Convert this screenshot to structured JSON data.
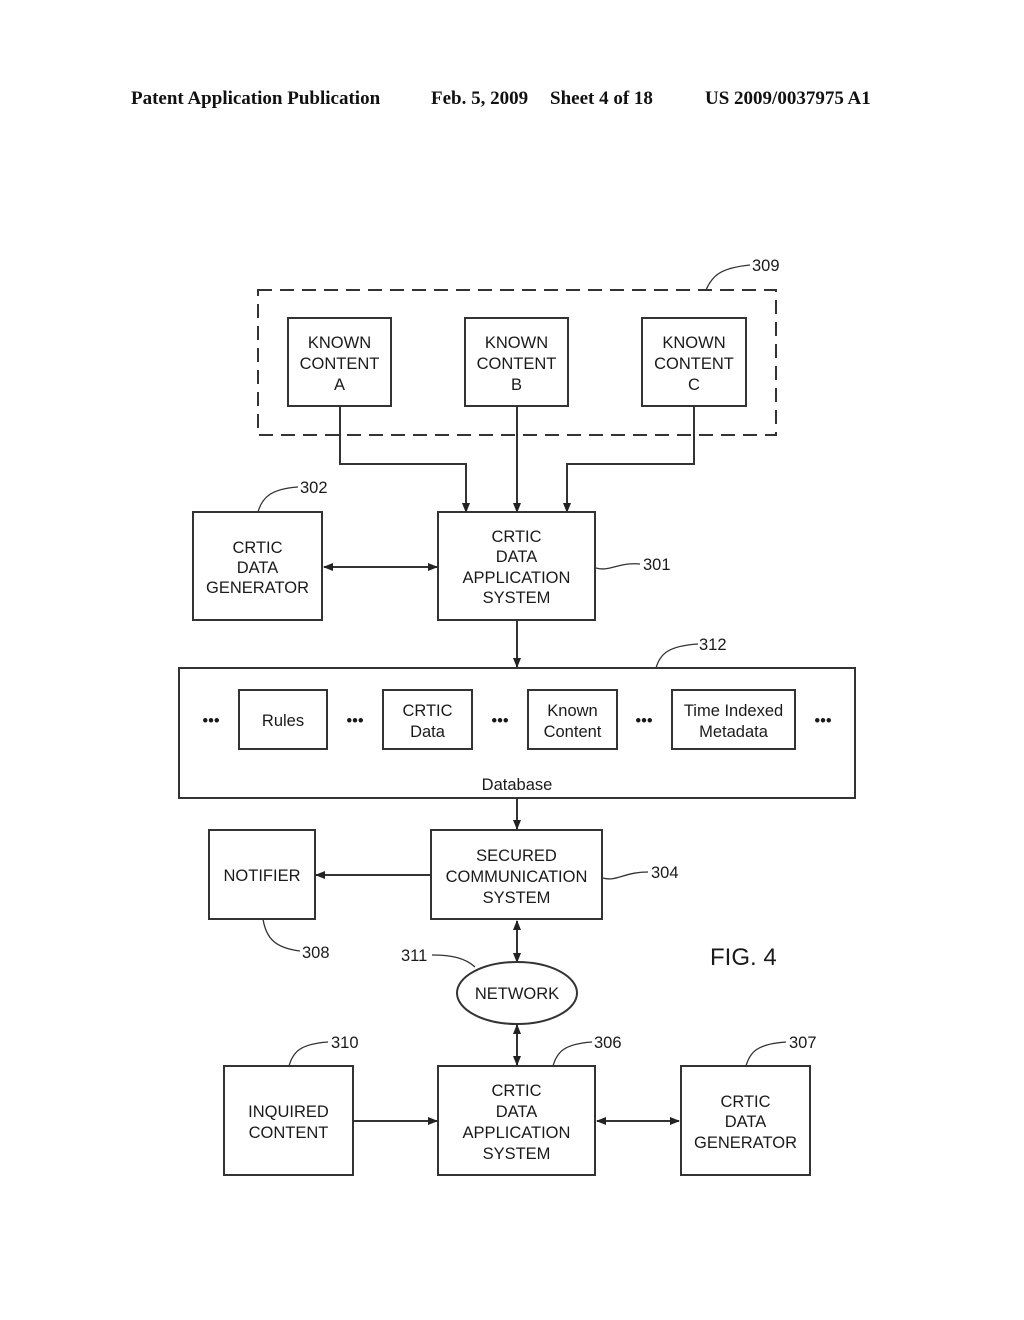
{
  "header": {
    "publication": "Patent Application Publication",
    "date": "Feb. 5, 2009",
    "sheet": "Sheet 4 of 18",
    "number": "US 2009/0037975 A1"
  },
  "figure_label": "FIG. 4",
  "group_309": {
    "ref": "309",
    "items": [
      {
        "lines": [
          "KNOWN",
          "CONTENT",
          "A"
        ]
      },
      {
        "lines": [
          "KNOWN",
          "CONTENT",
          "B"
        ]
      },
      {
        "lines": [
          "KNOWN",
          "CONTENT",
          "C"
        ]
      }
    ]
  },
  "generator_302": {
    "ref": "302",
    "lines": [
      "CRTIC",
      "DATA",
      "GENERATOR"
    ]
  },
  "app_system_301": {
    "ref": "301",
    "lines": [
      "CRTIC",
      "DATA",
      "APPLICATION",
      "SYSTEM"
    ]
  },
  "database_312": {
    "ref": "312",
    "label": "Database",
    "ellipsis": "•••",
    "items": [
      {
        "lines": [
          "Rules"
        ]
      },
      {
        "lines": [
          "CRTIC",
          "Data"
        ]
      },
      {
        "lines": [
          "Known",
          "Content"
        ]
      },
      {
        "lines": [
          "Time Indexed",
          "Metadata"
        ]
      }
    ]
  },
  "secured_comm_304": {
    "ref": "304",
    "lines": [
      "SECURED",
      "COMMUNICATION",
      "SYSTEM"
    ]
  },
  "notifier_308": {
    "ref": "308",
    "lines": [
      "NOTIFIER"
    ]
  },
  "network_311": {
    "ref": "311",
    "label": "NETWORK"
  },
  "inquired_310": {
    "ref": "310",
    "lines": [
      "INQUIRED",
      "CONTENT"
    ]
  },
  "app_system_306": {
    "ref": "306",
    "lines": [
      "CRTIC",
      "DATA",
      "APPLICATION",
      "SYSTEM"
    ]
  },
  "generator_307": {
    "ref": "307",
    "lines": [
      "CRTIC",
      "DATA",
      "GENERATOR"
    ]
  }
}
